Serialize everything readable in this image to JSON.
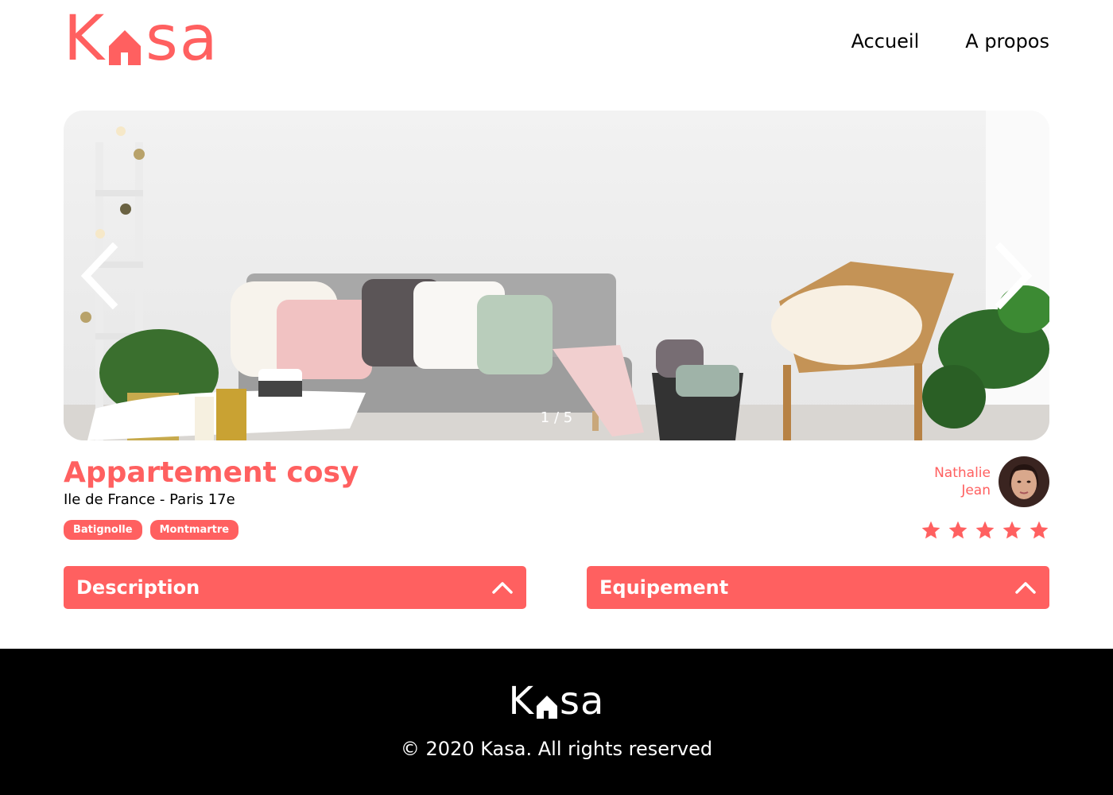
{
  "brand": {
    "logo_parts": [
      "K",
      "sa"
    ],
    "logo_text": "Kasa",
    "color": "#FF6060"
  },
  "nav": {
    "items": [
      {
        "label": "Accueil"
      },
      {
        "label": "A propos"
      }
    ]
  },
  "carousel": {
    "counter": "1 / 5",
    "current": 1,
    "total": 5,
    "prev_icon": "chevron-left-icon",
    "next_icon": "chevron-right-icon"
  },
  "listing": {
    "title": "Appartement cosy",
    "location": "Ile de France - Paris 17e",
    "tags": [
      "Batignolle",
      "Montmartre"
    ],
    "host": {
      "first_name": "Nathalie",
      "last_name": "Jean"
    },
    "rating": 5,
    "rating_max": 5
  },
  "sections": [
    {
      "label": "Description",
      "icon": "chevron-up-icon"
    },
    {
      "label": "Equipement",
      "icon": "chevron-up-icon"
    }
  ],
  "footer": {
    "logo_parts": [
      "K",
      "sa"
    ],
    "copyright": "© 2020 Kasa. All rights reserved"
  }
}
